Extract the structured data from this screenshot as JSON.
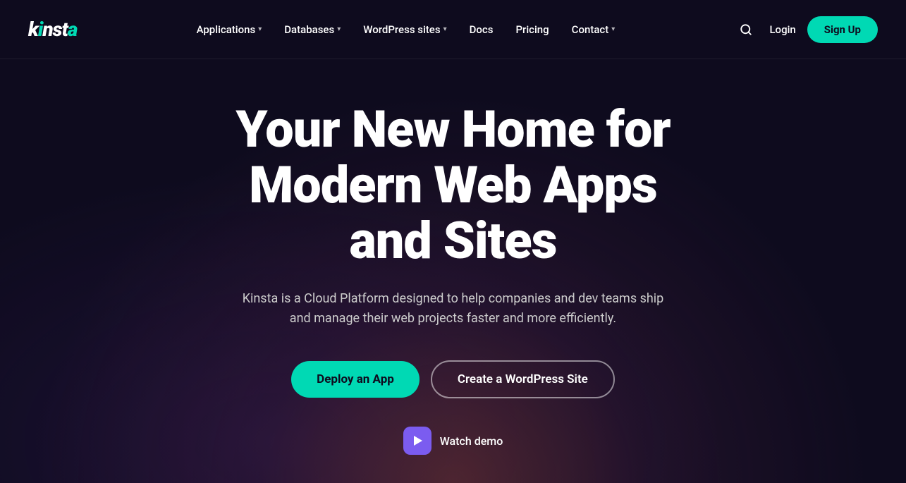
{
  "brand": {
    "logo_text": "kinsta",
    "logo_highlight": "a"
  },
  "nav": {
    "links": [
      {
        "label": "Applications",
        "has_dropdown": true
      },
      {
        "label": "Databases",
        "has_dropdown": true
      },
      {
        "label": "WordPress sites",
        "has_dropdown": true
      },
      {
        "label": "Docs",
        "has_dropdown": false
      },
      {
        "label": "Pricing",
        "has_dropdown": false
      },
      {
        "label": "Contact",
        "has_dropdown": true
      }
    ],
    "login_label": "Login",
    "signup_label": "Sign Up",
    "search_icon": "search"
  },
  "hero": {
    "title": "Your New Home for Modern Web Apps and Sites",
    "subtitle": "Kinsta is a Cloud Platform designed to help companies and dev teams ship and manage their web projects faster and more efficiently.",
    "btn_primary": "Deploy an App",
    "btn_secondary": "Create a WordPress Site",
    "watch_demo": "Watch demo"
  },
  "colors": {
    "accent": "#00d9b4",
    "bg": "#0e0b1e",
    "play_bg": "#7b5cf0"
  }
}
